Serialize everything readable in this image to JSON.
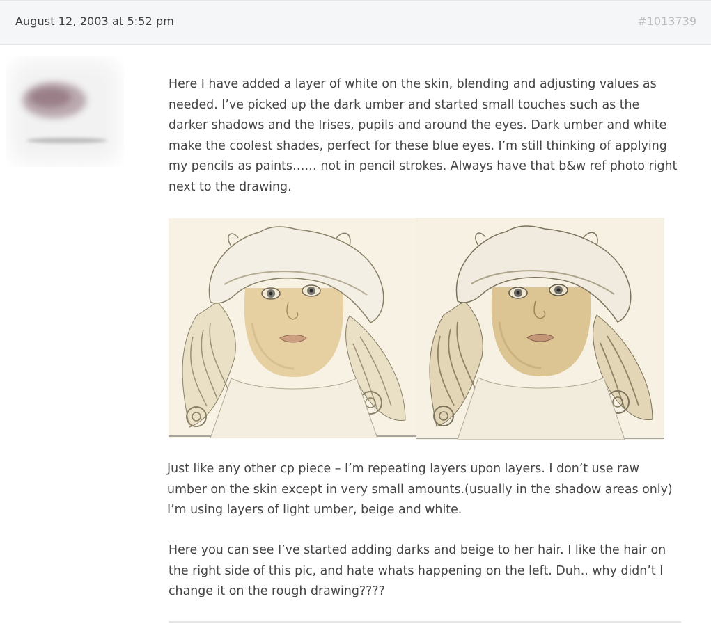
{
  "post": {
    "date": "August 12, 2003 at 5:52 pm",
    "id": "#1013739",
    "paragraphs": [
      "Here I have added a layer of white on the skin, blending and adjusting values as needed. I’ve picked up the dark umber and started small touches such as the darker shadows and the Irises, pupils and around the eyes. Dark umber and white make the coolest shades, perfect for these blue eyes. I’m still thinking of applying my pencils as paints…… not in pencil strokes. Always have that b&w ref photo right next to the drawing.",
      "Just like any other cp piece – I’m repeating layers upon layers. I don’t use raw umber on the skin except in very small amounts.(usually in the shadow areas only) I’m using layers of light umber, beige and white.",
      "Here you can see I’ve started adding darks and beige to her hair. I like the hair on the right side of this pic, and hate whats happening on the left. Duh.. why didn’t I change it on the rough drawing????"
    ]
  },
  "colors": {
    "header_bg": "#f5f6f7",
    "text": "#444444",
    "id_text": "#b9bcc0",
    "sketch_paper": "#f7f2e3",
    "sketch_line": "#8a8068",
    "skin": "#e6cfa0"
  },
  "images": [
    {
      "name": "progress-photo-left"
    },
    {
      "name": "progress-photo-right"
    }
  ]
}
